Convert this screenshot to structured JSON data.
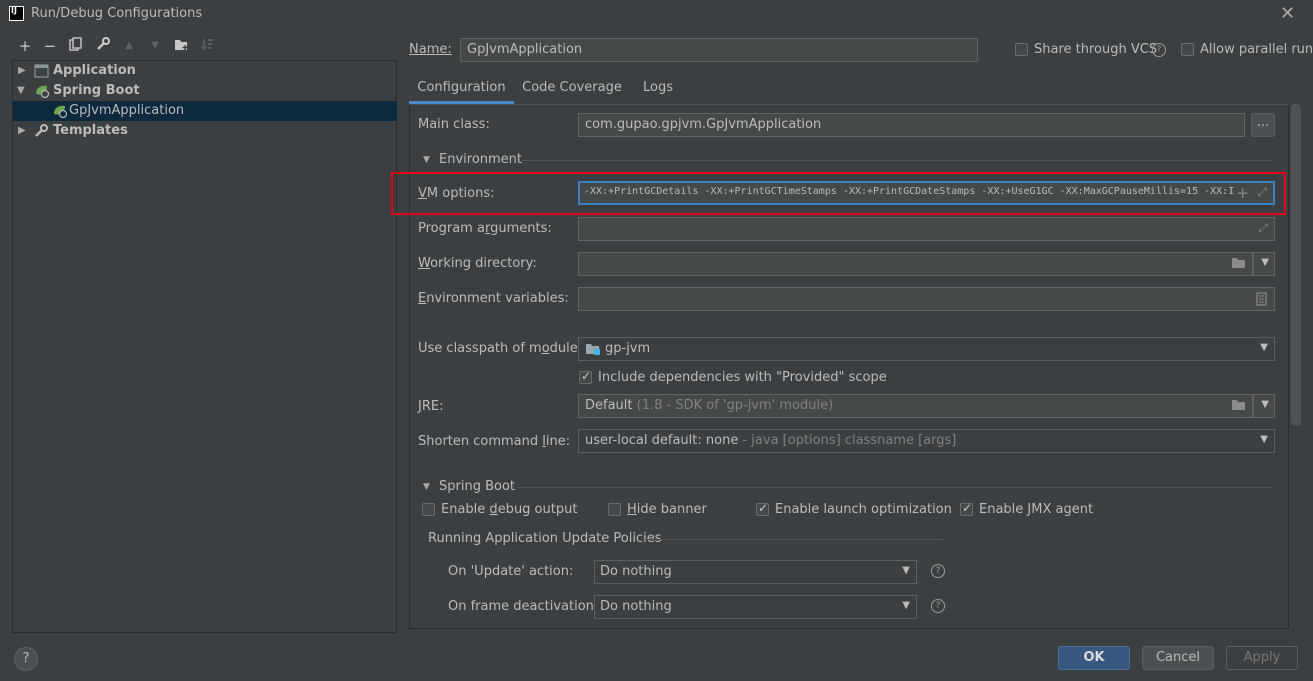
{
  "window": {
    "title": "Run/Debug Configurations",
    "icon_text": "IJ"
  },
  "toolbar": {
    "icons": [
      "add-icon",
      "remove-icon",
      "copy-icon",
      "wrench-icon",
      "move-up-icon",
      "move-down-icon",
      "new-folder-icon",
      "sort-icon"
    ]
  },
  "tree": {
    "items": [
      {
        "label": "Application"
      },
      {
        "label": "Spring Boot"
      },
      {
        "label": "GpJvmApplication"
      },
      {
        "label": "Templates"
      }
    ]
  },
  "header": {
    "name_label": "Name:",
    "name_value": "GpJvmApplication",
    "share_label": "Share through VCS",
    "parallel_label": "Allow parallel run"
  },
  "tabs": [
    {
      "label": "Configuration"
    },
    {
      "label": "Code Coverage"
    },
    {
      "label": "Logs"
    }
  ],
  "config": {
    "main_class_label": "Main class:",
    "main_class_value": "com.gupao.gpjvm.GpJvmApplication",
    "browse_label": "...",
    "environment_label": "Environment",
    "vm_options_label": "VM options:",
    "vm_options_value": "-XX:+PrintGCDetails -XX:+PrintGCTimeStamps -XX:+PrintGCDateStamps -XX:+UseG1GC -XX:MaxGCPauseMillis=15 -XX:I",
    "program_args_label": "Program arguments:",
    "working_dir_label": "Working directory:",
    "env_vars_label": "Environment variables:",
    "classpath_label": "Use classpath of module:",
    "classpath_value": "gp-jvm",
    "include_deps_label": "Include dependencies with \"Provided\" scope",
    "jre_label": "JRE:",
    "jre_value": "Default",
    "jre_hint": "(1.8 - SDK of 'gp-jvm' module)",
    "shorten_label": "Shorten command line:",
    "shorten_value": "user-local default: none",
    "shorten_hint": "- java [options] classname [args]"
  },
  "spring_boot": {
    "section_label": "Spring Boot",
    "debug_output_label": "Enable debug output",
    "hide_banner_label": "Hide banner",
    "launch_opt_label": "Enable launch optimization",
    "jmx_label": "Enable JMX agent",
    "policies_label": "Running Application Update Policies",
    "on_update_label": "On 'Update' action:",
    "on_update_value": "Do nothing",
    "on_frame_label": "On frame deactivation:",
    "on_frame_value": "Do nothing"
  },
  "footer": {
    "ok_label": "OK",
    "cancel_label": "Cancel",
    "apply_label": "Apply",
    "help_label": "?"
  },
  "colors": {
    "highlight_border": "#e0001a",
    "selection": "#0d293e",
    "primary_button": "#365880"
  }
}
